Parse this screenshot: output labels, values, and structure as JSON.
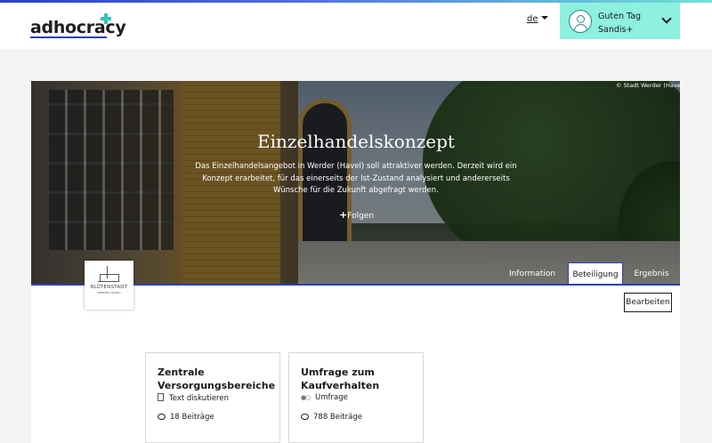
{
  "header": {
    "logo_text": "adhocracy",
    "language": "de",
    "user": {
      "greeting": "Guten Tag",
      "name": "Sandis+"
    }
  },
  "hero": {
    "image_credit": "© Stadt Werder (Havel)",
    "title": "Einzelhandelskonzept",
    "description": "Das Einzelhandelsangebot in Werder (Havel) soll attraktiver werden. Derzeit wird ein Konzept erarbeitet, für das einerseits der Ist-Zustand analysiert und andererseits Wünsche für die Zukunft abgefragt werden.",
    "follow_label": "Folgen"
  },
  "tabs": [
    {
      "label": "Information",
      "active": false
    },
    {
      "label": "Beteiligung",
      "active": true
    },
    {
      "label": "Ergebnis",
      "active": false
    }
  ],
  "organisation": {
    "logo_name": "BLÜTENSTADT",
    "logo_sub": "WERDER (HAVEL)"
  },
  "edit_label": "Bearbeiten",
  "modules": [
    {
      "title": "Zentrale Versorgungsbereiche",
      "type": "Text diskutieren",
      "type_icon": "document-icon",
      "count": "18 Beiträge"
    },
    {
      "title": "Umfrage zum Kaufverhalten",
      "type": "Umfrage",
      "type_icon": "poll-icon",
      "count": "788 Beiträge"
    }
  ],
  "colors": {
    "accent": "#2b3fbf",
    "user_box": "#8ef0df",
    "logo_plus": "#32c6b6"
  }
}
